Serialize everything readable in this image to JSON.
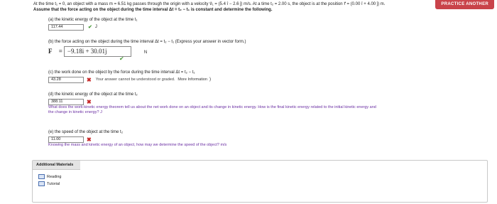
{
  "header": {
    "practice_button": "PRACTICE ANOTHER"
  },
  "problem": {
    "line1": "At the time t₁ = 0, an object with a mass m = 6.51 kg passes through the origin with a velocity v⃗₁ = (5.4 î − 2.6 ĵ) m/s. At a time t₂ = 2.00 s, the object is at the position r⃗ = (0.00 î + 4.00 ĵ) m.",
    "line2": "Assume that the force acting on the object during the time interval Δt = t₂ − t₁ is constant and determine the following."
  },
  "parts": {
    "a": {
      "label": "(a) the kinetic energy of the object at the time t₁",
      "value": "117.44",
      "unit": "J"
    },
    "b": {
      "label": "(b) the force acting on the object during the time interval Δt = t₂ − t₁ (Express your answer in vector form.)",
      "vector_label": "F⃗ =",
      "value": "−9.18i + 30.01j",
      "unit": "N"
    },
    "c": {
      "label": "(c) the work done on the object by the force during the time interval Δt = t₂ − t₁",
      "value": "43.28",
      "feedback": "Your answer cannot be understood or graded.",
      "help": "More Information",
      "help_mark": ")"
    },
    "d": {
      "label": "(d) the kinetic energy of the object at the time t₂",
      "value": "388.11",
      "hint_line1": "What does the work-kinetic energy theorem tell us about the net work done on an object and its change in kinetic energy. How is the final kinetic energy related to the initial kinetic energy and",
      "hint_line2": "the change in kinetic energy? J"
    },
    "e": {
      "label": "(e) the speed of the object at the time t₂",
      "value": "11.00",
      "hint": "Knowing the mass and kinetic energy of an object, how may we determine the speed of the object? m/s"
    }
  },
  "materials": {
    "title": "Additional Materials",
    "items": [
      "Reading",
      "Tutorial"
    ]
  }
}
